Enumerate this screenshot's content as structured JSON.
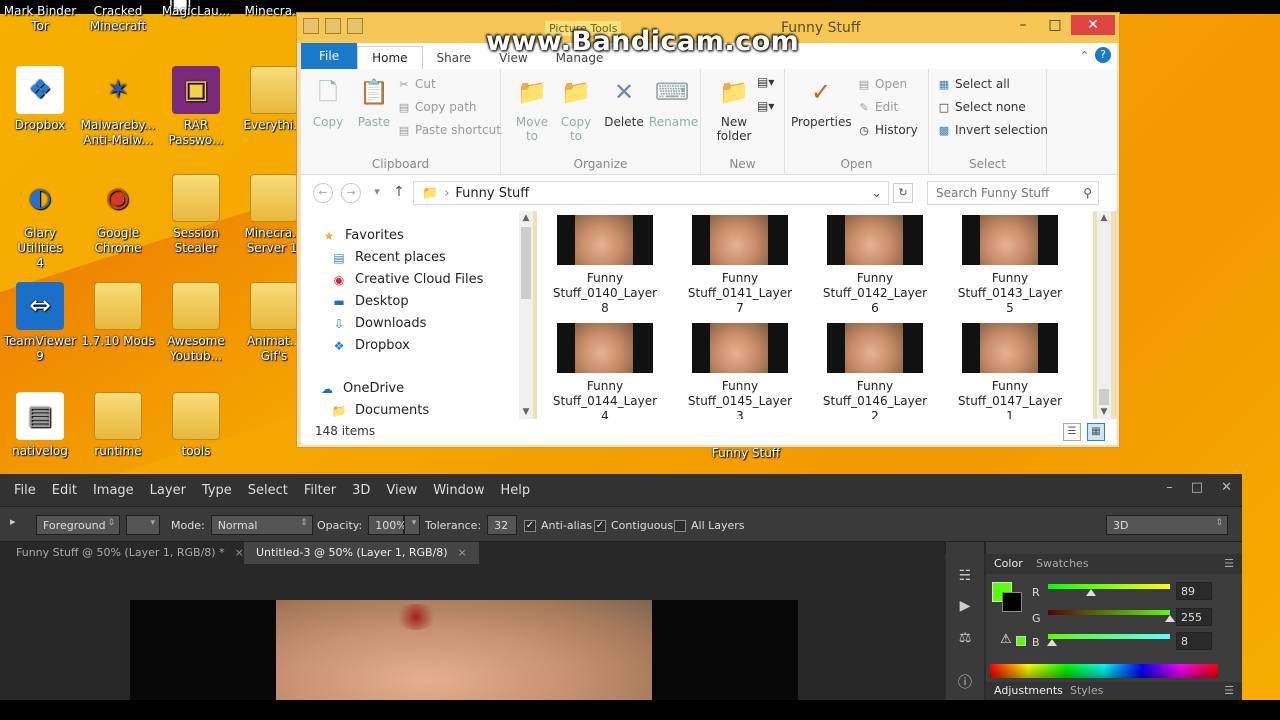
{
  "watermark": "www.Bandicam.com",
  "desktop": {
    "icons": [
      {
        "label": "Mark Binder\nTor",
        "icon": "tor-folder-icon"
      },
      {
        "label": "Cracked\nMinecraft",
        "icon": "folder-icon"
      },
      {
        "label": "MagicLau...",
        "icon": "app-icon"
      },
      {
        "label": "Minecra...",
        "icon": "folder-icon"
      },
      {
        "label": "Dropbox",
        "icon": "dropbox-icon"
      },
      {
        "label": "Malwareby...\nAnti-Malw...",
        "icon": "malwarebytes-icon"
      },
      {
        "label": "RAR\nPasswo...",
        "icon": "winrar-icon"
      },
      {
        "label": "Everythi...",
        "icon": "folder-icon"
      },
      {
        "label": "Glary Utilities\n4",
        "icon": "glary-icon"
      },
      {
        "label": "Google\nChrome",
        "icon": "chrome-icon"
      },
      {
        "label": "Session\nStealer",
        "icon": "folder-icon"
      },
      {
        "label": "Minecra...\nServer 1.",
        "icon": "folder-icon"
      },
      {
        "label": "TeamViewer\n9",
        "icon": "teamviewer-icon"
      },
      {
        "label": "1.7.10 Mods",
        "icon": "folder-icon"
      },
      {
        "label": "Awesome\nYoutub...",
        "icon": "folder-icon"
      },
      {
        "label": "Animat...\nGif's",
        "icon": "folder-icon"
      },
      {
        "label": "nativelog",
        "icon": "text-file-icon"
      },
      {
        "label": "runtime",
        "icon": "folder-icon"
      },
      {
        "label": "tools",
        "icon": "folder-icon"
      }
    ],
    "behind_label": "Funny Stuff"
  },
  "explorer": {
    "title": "Funny Stuff",
    "context_tab": "Picture Tools",
    "tabs": [
      "File",
      "Home",
      "Share",
      "View",
      "Manage"
    ],
    "clipboard": {
      "copy": "Copy",
      "paste": "Paste",
      "cut": "Cut",
      "copy_path": "Copy path",
      "paste_shortcut": "Paste shortcut",
      "group": "Clipboard"
    },
    "organize": {
      "move_to": "Move to",
      "copy_to": "Copy to",
      "delete": "Delete",
      "rename": "Rename",
      "group": "Organize"
    },
    "new": {
      "new_folder": "New folder",
      "group": "New"
    },
    "open": {
      "properties": "Properties",
      "open": "Open",
      "edit": "Edit",
      "history": "History",
      "group": "Open"
    },
    "select": {
      "select_all": "Select all",
      "select_none": "Select none",
      "invert": "Invert selection",
      "group": "Select"
    },
    "address": "Funny Stuff",
    "search_placeholder": "Search Funny Stuff",
    "nav": [
      {
        "label": "Favorites",
        "icon": "star-icon"
      },
      {
        "label": "Recent places",
        "icon": "recent-places-icon"
      },
      {
        "label": "Creative Cloud Files",
        "icon": "creative-cloud-icon"
      },
      {
        "label": "Desktop",
        "icon": "desktop-icon"
      },
      {
        "label": "Downloads",
        "icon": "downloads-icon"
      },
      {
        "label": "Dropbox",
        "icon": "dropbox-icon"
      },
      {
        "label": "OneDrive",
        "icon": "onedrive-icon"
      },
      {
        "label": "Documents",
        "icon": "folder-icon"
      }
    ],
    "files": [
      "Funny\nStuff_0140_Layer\n8",
      "Funny\nStuff_0141_Layer\n7",
      "Funny\nStuff_0142_Layer\n6",
      "Funny\nStuff_0143_Layer\n5",
      "Funny\nStuff_0144_Layer\n4",
      "Funny\nStuff_0145_Layer\n3",
      "Funny\nStuff_0146_Layer\n2",
      "Funny\nStuff_0147_Layer\n1"
    ],
    "status": "148 items"
  },
  "photoshop": {
    "menu": [
      "File",
      "Edit",
      "Image",
      "Layer",
      "Type",
      "Select",
      "Filter",
      "3D",
      "View",
      "Window",
      "Help"
    ],
    "options": {
      "fill_source": "Foreground",
      "mode_label": "Mode:",
      "mode": "Normal",
      "opacity_label": "Opacity:",
      "opacity": "100%",
      "tolerance_label": "Tolerance:",
      "tolerance": "32",
      "anti_alias": "Anti-alias",
      "contiguous": "Contiguous",
      "all_layers": "All Layers",
      "workspace": "3D"
    },
    "tabs": [
      {
        "label": "Funny Stuff @ 50% (Layer 1, RGB/8) *",
        "active": false
      },
      {
        "label": "Untitled-3 @ 50% (Layer 1, RGB/8)",
        "active": true
      }
    ],
    "color_panel": {
      "tab_color": "Color",
      "tab_swatches": "Swatches",
      "r_label": "R",
      "g_label": "G",
      "b_label": "B",
      "r": 89,
      "g": 255,
      "b": 8,
      "foreground": "#59ff08",
      "tab_adjustments": "Adjustments",
      "tab_styles": "Styles"
    }
  }
}
